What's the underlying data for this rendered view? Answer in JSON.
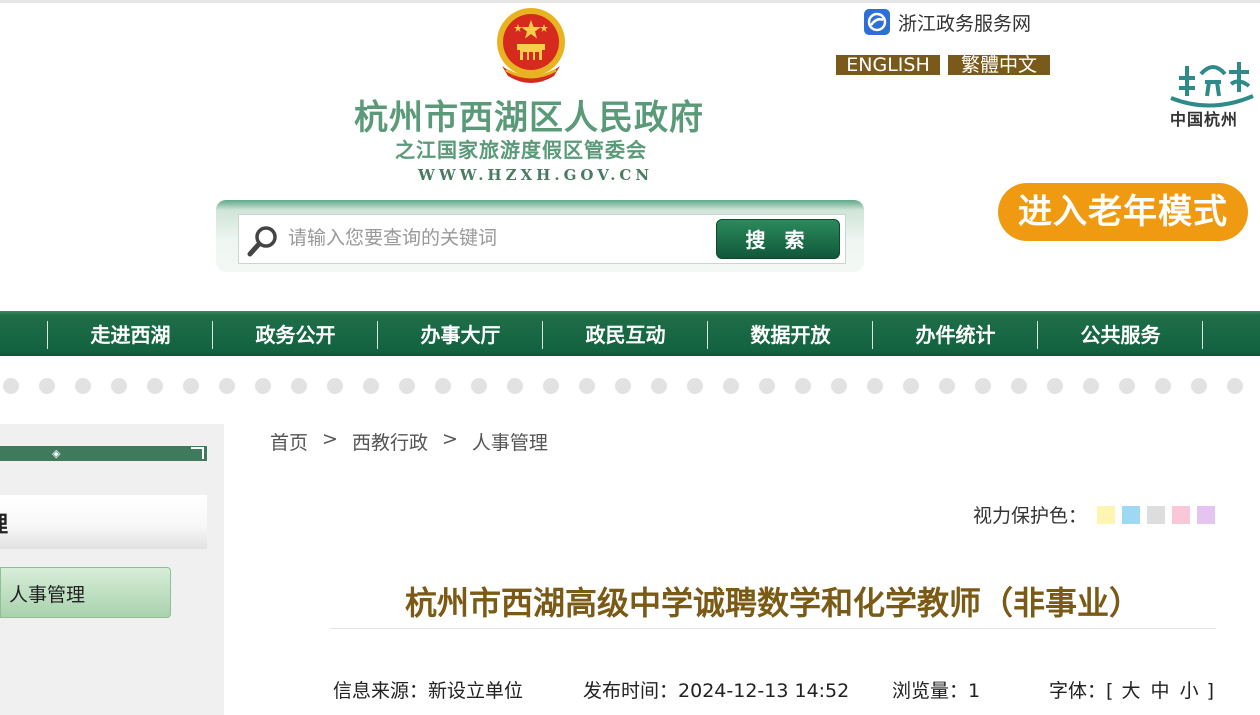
{
  "header": {
    "site_title": "杭州市西湖区人民政府",
    "site_subtitle": "之江国家旅游度假区管委会",
    "site_domain": "WWW.HZXH.GOV.CN",
    "zj_link": "浙江政务服务网",
    "lang_en": "ENGLISH",
    "lang_tw": "繁體中文",
    "city_logo_text": "中国杭州",
    "elder_mode": "进入老年模式"
  },
  "search": {
    "placeholder": "请输入您要查询的关键词",
    "button": "搜 索"
  },
  "nav": {
    "items": [
      "走进西湖",
      "政务公开",
      "办事大厅",
      "政民互动",
      "数据开放",
      "办件统计",
      "公共服务"
    ]
  },
  "sidebar": {
    "heading": "理",
    "item": "人事管理"
  },
  "breadcrumb": {
    "items": [
      "首页",
      "西教行政",
      "人事管理"
    ],
    "separator": ">"
  },
  "vision": {
    "label": "视力保护色：",
    "colors": [
      "#fdf5b0",
      "#9fd8f2",
      "#dddddd",
      "#f9c8d8",
      "#e6c4f2"
    ]
  },
  "article": {
    "title": "杭州市西湖高级中学诚聘数学和化学教师（非事业）",
    "source_label": "信息来源：",
    "source": "新设立单位",
    "time_label": "发布时间：",
    "time": "2024-12-13 14:52",
    "views_label": "浏览量：",
    "views": "1",
    "font_label": "字体：",
    "font_open": "[",
    "font_large": "大",
    "font_medium": "中",
    "font_small": "小",
    "font_close": "]"
  },
  "colors": {
    "brand_green": "#136240",
    "accent_orange": "#f09a12",
    "title_brown": "#7a5a14"
  }
}
